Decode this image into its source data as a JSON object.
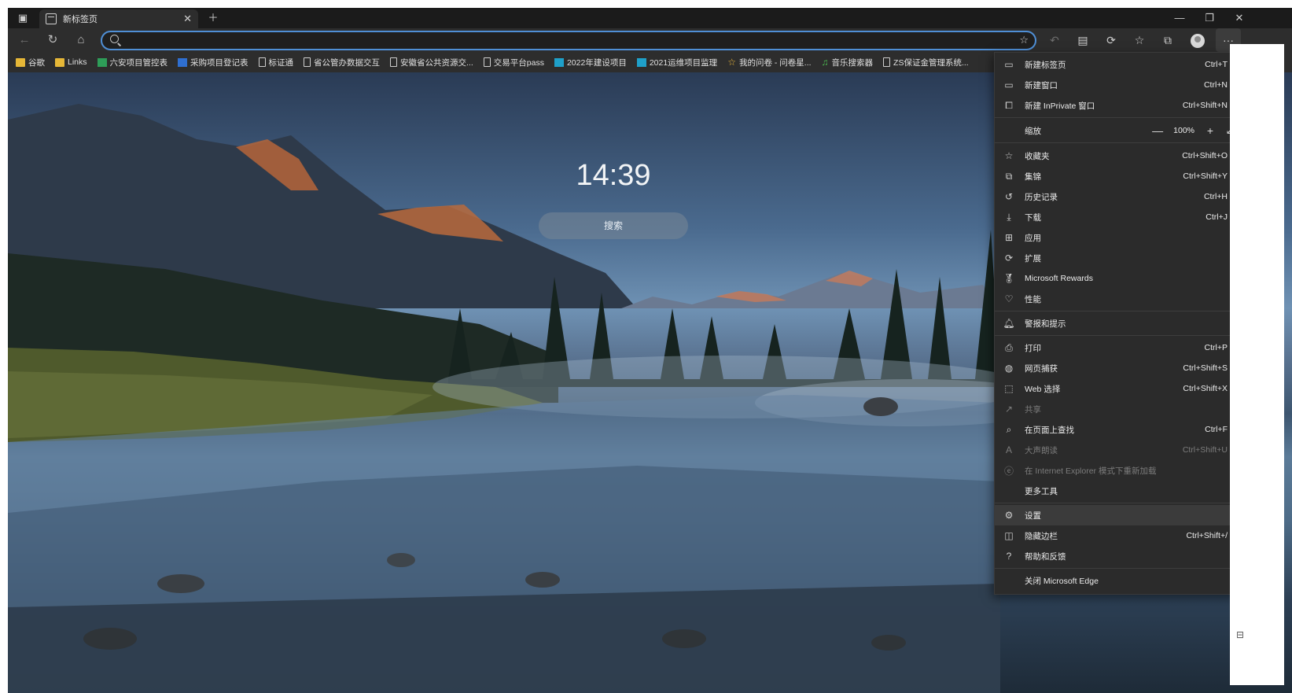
{
  "tab": {
    "title": "新标签页"
  },
  "address": {
    "value": "",
    "placeholder": ""
  },
  "bookmarks": [
    {
      "label": "谷歌",
      "icon": "folder-icon"
    },
    {
      "label": "Links",
      "icon": "folder-icon"
    },
    {
      "label": "六安项目管控表",
      "icon": "sheet-icon"
    },
    {
      "label": "采购项目登记表",
      "icon": "sheet-icon"
    },
    {
      "label": "标证通",
      "icon": "page-icon"
    },
    {
      "label": "省公管办数据交互",
      "icon": "page-icon"
    },
    {
      "label": "安徽省公共资源交...",
      "icon": "page-icon"
    },
    {
      "label": "交易平台pass",
      "icon": "page-icon"
    },
    {
      "label": "2022年建设项目",
      "icon": "sheet-icon"
    },
    {
      "label": "2021运维项目监理",
      "icon": "sheet-icon"
    },
    {
      "label": "我的问卷 - 问卷星...",
      "icon": "star-icon"
    },
    {
      "label": "音乐搜索器",
      "icon": "music-icon"
    },
    {
      "label": "ZS保证金管理系统...",
      "icon": "page-icon"
    }
  ],
  "newtab": {
    "clock": "14:39",
    "search_label": "搜索"
  },
  "menu": {
    "new_tab": {
      "label": "新建标签页",
      "shortcut": "Ctrl+T"
    },
    "new_window": {
      "label": "新建窗口",
      "shortcut": "Ctrl+N"
    },
    "new_inprivate": {
      "label": "新建 InPrivate 窗口",
      "shortcut": "Ctrl+Shift+N"
    },
    "zoom": {
      "label": "缩放",
      "value": "100%"
    },
    "favorites": {
      "label": "收藏夹",
      "shortcut": "Ctrl+Shift+O"
    },
    "collections": {
      "label": "集锦",
      "shortcut": "Ctrl+Shift+Y"
    },
    "history": {
      "label": "历史记录",
      "shortcut": "Ctrl+H"
    },
    "downloads": {
      "label": "下载",
      "shortcut": "Ctrl+J"
    },
    "apps": {
      "label": "应用"
    },
    "extensions": {
      "label": "扩展"
    },
    "rewards": {
      "label": "Microsoft Rewards"
    },
    "performance": {
      "label": "性能"
    },
    "alerts": {
      "label": "警报和提示"
    },
    "print": {
      "label": "打印",
      "shortcut": "Ctrl+P"
    },
    "web_capture": {
      "label": "网页捕获",
      "shortcut": "Ctrl+Shift+S"
    },
    "web_select": {
      "label": "Web 选择",
      "shortcut": "Ctrl+Shift+X"
    },
    "share": {
      "label": "共享"
    },
    "find": {
      "label": "在页面上查找",
      "shortcut": "Ctrl+F"
    },
    "read_aloud": {
      "label": "大声朗读",
      "shortcut": "Ctrl+Shift+U"
    },
    "ie_mode": {
      "label": "在 Internet Explorer 模式下重新加载"
    },
    "more_tools": {
      "label": "更多工具"
    },
    "settings": {
      "label": "设置"
    },
    "hide_sidebar": {
      "label": "隐藏边栏",
      "shortcut": "Ctrl+Shift+/"
    },
    "help": {
      "label": "帮助和反馈"
    },
    "close_edge": {
      "label": "关闭 Microsoft Edge"
    }
  }
}
